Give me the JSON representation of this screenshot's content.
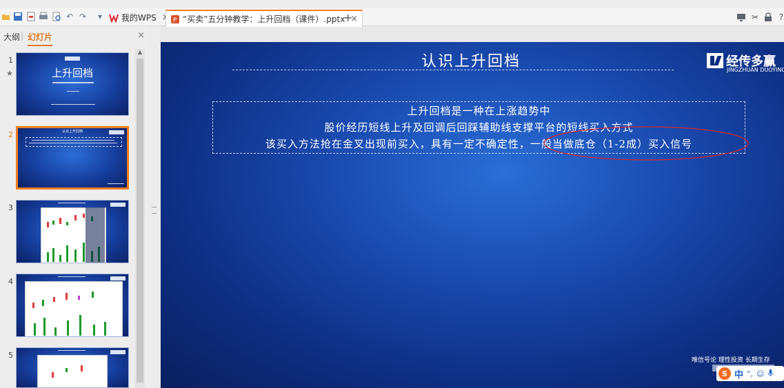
{
  "tabs": [
    {
      "label": "我的WPS",
      "close": "×"
    },
    {
      "label": "“买卖”五分钟教学：上升回档（课件）.pptx",
      "close": "×"
    }
  ],
  "new_tab": "+",
  "left_panel": {
    "outline_tab": "大纲",
    "separator": "|",
    "slides_tab": "幻灯片",
    "close": "×",
    "slides": [
      {
        "number": "1",
        "title": "上升回档",
        "marked": true
      },
      {
        "number": "2",
        "title": "认识上升回档",
        "selected": true
      },
      {
        "number": "3",
        "title": ""
      },
      {
        "number": "4",
        "title": ""
      },
      {
        "number": "5",
        "title": ""
      }
    ]
  },
  "slide": {
    "title": "认识上升回档",
    "logo_cn": "经传多赢",
    "logo_en": "JINGZHUAN DUOYING",
    "lines": [
      "上升回档是一种在上涨趋势中",
      "股价经历短线上升及回调后回踩辅助线支撑平台的短线买入方式",
      "该买入方法抢在金叉出现前买入，具有一定不确定性，一般当做底仓（1-2成）买入信号"
    ],
    "footer": "唯信号论 理性投资 长期生存",
    "annotation_color": "#d9262c"
  },
  "ime": {
    "logo": "S",
    "lang": "中"
  },
  "colors": {
    "accent": "#f07d22",
    "slide_bg": "#1a4bb0"
  }
}
